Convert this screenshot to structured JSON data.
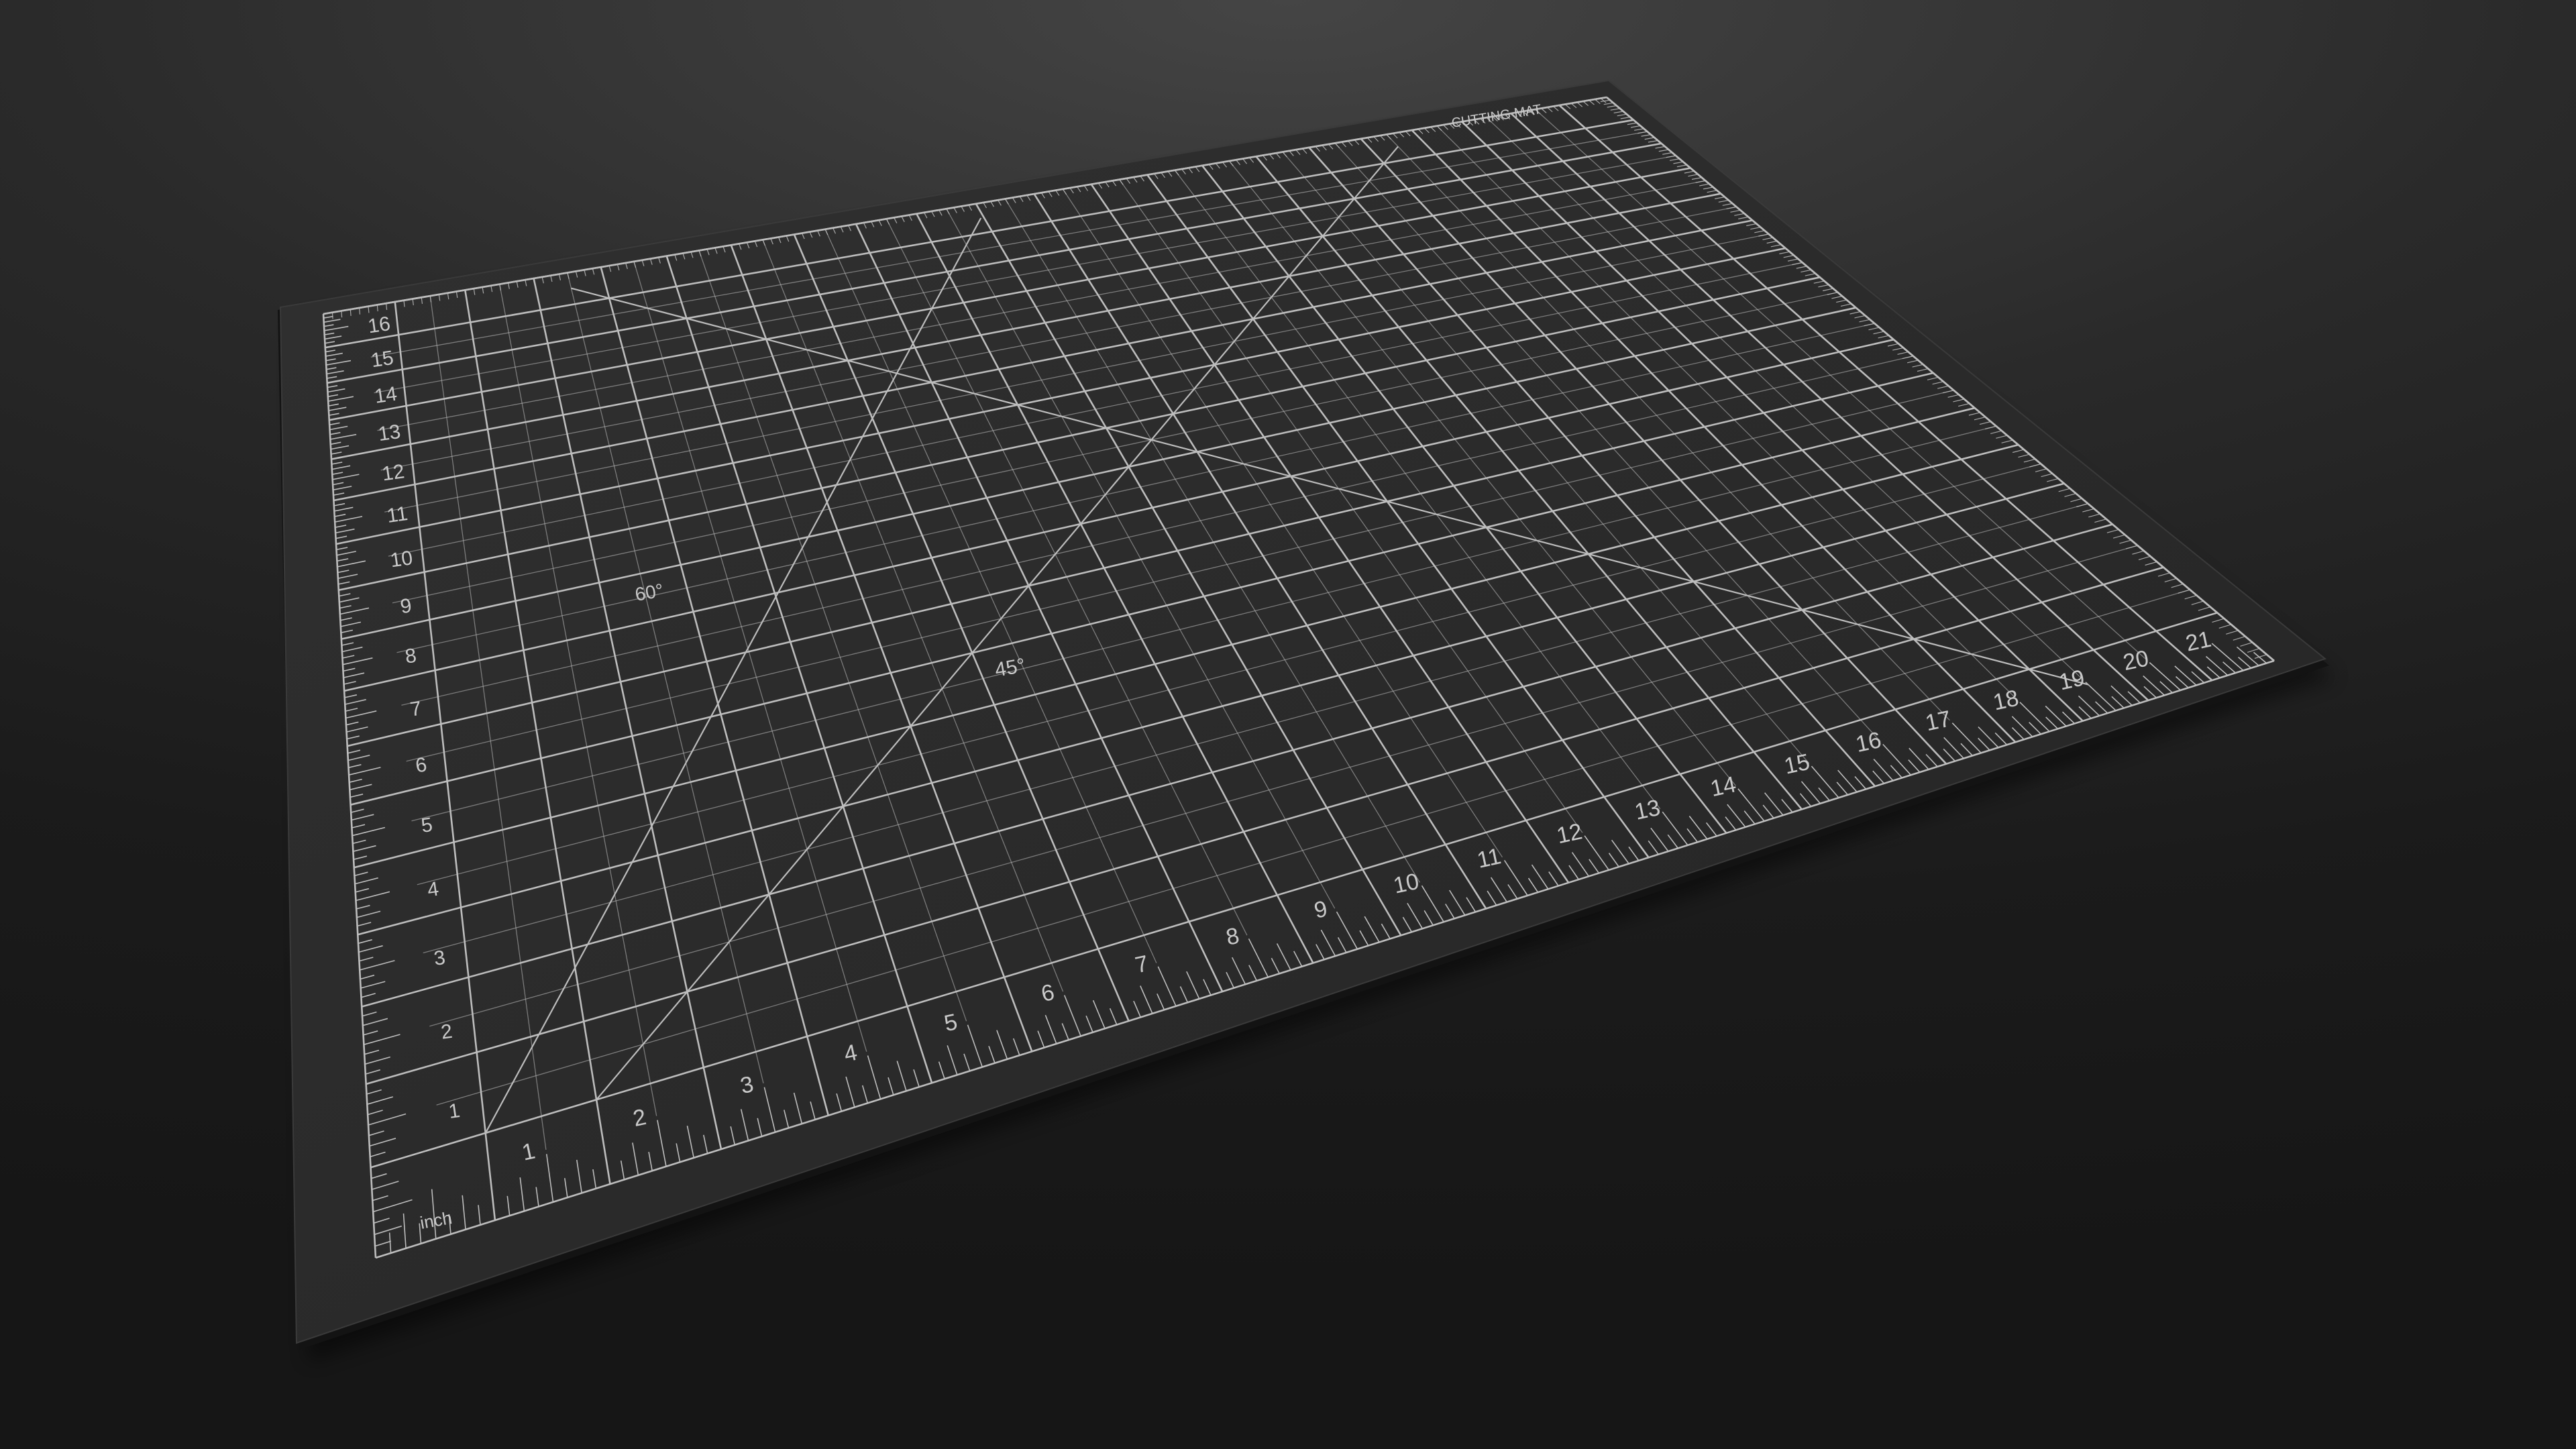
{
  "scene": {
    "background_top": "#454545",
    "background_bottom": "#161616"
  },
  "mat": {
    "surface_color": "#2b2b2b",
    "edge_color": "#121212",
    "line_color": "#bdbdbd",
    "grid_columns": 22,
    "grid_rows": 17,
    "subdivisions": 2,
    "bottom_ruler_numbers": [
      "1",
      "2",
      "3",
      "4",
      "5",
      "6",
      "7",
      "8",
      "9",
      "10",
      "11",
      "12",
      "13",
      "14",
      "15",
      "16",
      "17",
      "18",
      "19",
      "20",
      "21"
    ],
    "left_ruler_numbers": [
      "1",
      "2",
      "3",
      "4",
      "5",
      "6",
      "7",
      "8",
      "9",
      "10",
      "11",
      "12",
      "13",
      "14",
      "15",
      "16"
    ],
    "unit_label": "inch",
    "angle_labels": [
      "60°",
      "45°"
    ],
    "brand_text": "CUTTING MAT"
  }
}
